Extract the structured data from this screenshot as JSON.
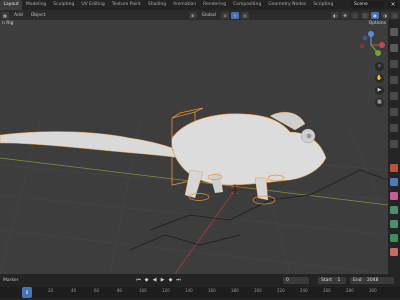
{
  "topbar": {
    "tabs": [
      "Layout",
      "Modeling",
      "Sculpting",
      "UV Editing",
      "Texture Paint",
      "Shading",
      "Animation",
      "Rendering",
      "Compositing",
      "Geometry Nodes",
      "Scripting"
    ],
    "scene": "Scene"
  },
  "header": {
    "items": [
      "Add",
      "Object"
    ],
    "transform": "Global"
  },
  "viewport": {
    "object_label": "n Rig",
    "options_label": "Options"
  },
  "timeline": {
    "marker": "Marker",
    "current_frame": "0",
    "start_label": "Start",
    "start_value": "1",
    "end_label": "End",
    "end_value": "2048",
    "ticks": [
      "0",
      "20",
      "40",
      "60",
      "80",
      "100",
      "120",
      "140",
      "160",
      "180",
      "200",
      "220",
      "240",
      "260",
      "280",
      "300"
    ]
  },
  "colors": {
    "accent": "#4772b3",
    "selection": "#e8903a",
    "grid": "#484848",
    "model": "#d9d9d9"
  }
}
